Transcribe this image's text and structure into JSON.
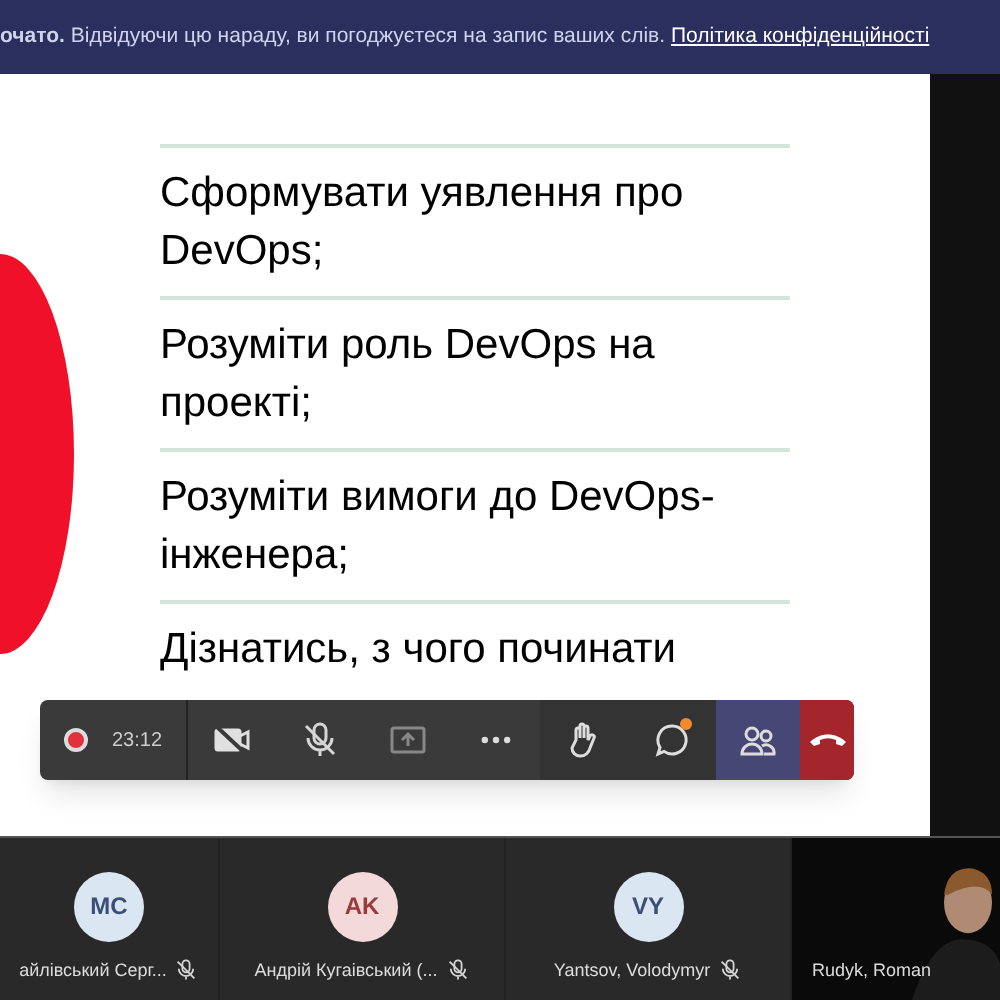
{
  "banner": {
    "text": "**очато.** Відвідуючи цю нараду, ви погоджуєтеся на запис ваших слів.",
    "link": "Політика конфіденційності"
  },
  "slide": {
    "items": [
      "Сформувати уявлення про DevOps;",
      "Розуміти роль DevOps на проекті;",
      "Розуміти вимоги до DevOps-інженера;",
      "Дізнатись, з чого починати"
    ]
  },
  "toolbar": {
    "recording": true,
    "time": "23:12",
    "camera_on": false,
    "mic_on": false,
    "chat_unread": true,
    "participants_selected": true
  },
  "participants": [
    {
      "kind": "avatar",
      "initials": "MC",
      "name": "айлівський Серг...",
      "color": "#dbe6f3",
      "muted": true
    },
    {
      "kind": "avatar",
      "initials": "AK",
      "name": "Андрій Кугаівський (...",
      "color": "#f3d9d9",
      "muted": true
    },
    {
      "kind": "avatar",
      "initials": "VY",
      "name": "Yantsov, Volodymyr",
      "color": "#dbe6f3",
      "muted": true
    },
    {
      "kind": "video",
      "name": "Rudyk, Roman"
    }
  ]
}
